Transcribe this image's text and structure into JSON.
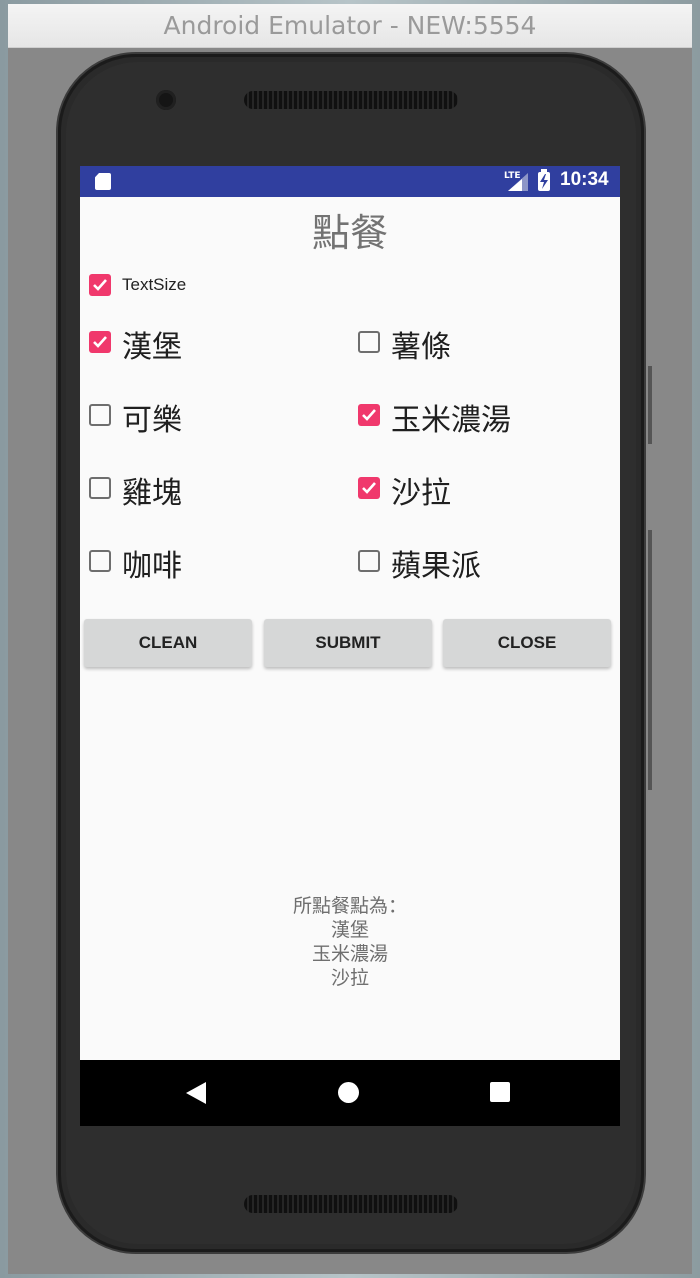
{
  "window": {
    "title": "Android Emulator - NEW:5554"
  },
  "statusbar": {
    "network": "LTE",
    "time": "10:34"
  },
  "app": {
    "title": "點餐",
    "textsize_checkbox": {
      "label": "TextSize",
      "checked": true
    },
    "items": [
      {
        "label": "漢堡",
        "checked": true
      },
      {
        "label": "薯條",
        "checked": false
      },
      {
        "label": "可樂",
        "checked": false
      },
      {
        "label": "玉米濃湯",
        "checked": true
      },
      {
        "label": "雞塊",
        "checked": false
      },
      {
        "label": "沙拉",
        "checked": true
      },
      {
        "label": "咖啡",
        "checked": false
      },
      {
        "label": "蘋果派",
        "checked": false
      }
    ],
    "buttons": {
      "clean": "CLEAN",
      "submit": "SUBMIT",
      "close": "CLOSE"
    },
    "result": {
      "heading": "所點餐點為：",
      "lines": [
        "漢堡",
        "玉米濃湯",
        "沙拉"
      ]
    }
  },
  "navbar": {
    "back_icon": "back-triangle-icon",
    "home_icon": "home-circle-icon",
    "recent_icon": "recent-square-icon"
  },
  "colors": {
    "statusbar": "#303f9f",
    "checkbox_accent": "#f0386c",
    "button_bg": "#d6d7d7"
  }
}
